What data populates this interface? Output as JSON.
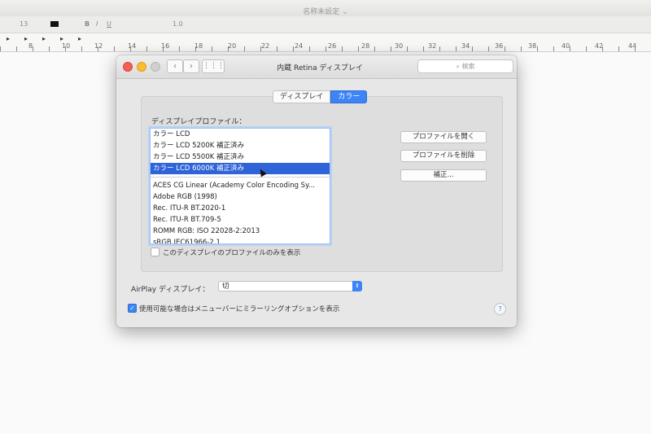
{
  "bg_app": {
    "doc_title": "名称未設定 ⌄",
    "toolbar": {
      "size": "13",
      "bold": "B",
      "italic": "I",
      "underline": "U",
      "spacing": "1.0"
    },
    "ruler_numbers": [
      "8",
      "10",
      "12",
      "14",
      "16",
      "18",
      "20",
      "22",
      "24",
      "26",
      "28",
      "30",
      "32",
      "34",
      "36",
      "38",
      "40",
      "42",
      "44"
    ]
  },
  "window": {
    "title": "内蔵 Retina ディスプレイ",
    "search_placeholder": "検索",
    "tabs": [
      {
        "label": "ディスプレイ"
      },
      {
        "label": "カラー"
      }
    ],
    "profile_label": "ディスプレイプロファイル：",
    "profiles_group1": [
      "カラー LCD",
      "カラー LCD 5200K 補正済み",
      "カラー LCD 5500K 補正済み",
      "カラー LCD 6000K 補正済み"
    ],
    "profiles_group2": [
      "ACES CG Linear (Academy Color Encoding Sy...",
      "Adobe RGB (1998)",
      "Rec. ITU-R BT.2020-1",
      "Rec. ITU-R BT.709-5",
      "ROMM RGB: ISO 22028-2:2013",
      "sRGB IEC61966-2.1"
    ],
    "selected_profile": "カラー LCD 6000K 補正済み",
    "buttons": {
      "open": "プロファイルを開く",
      "delete": "プロファイルを削除",
      "calibrate": "補正..."
    },
    "only_this_display": "このディスプレイのプロファイルのみを表示",
    "airplay_label": "AirPlay ディスプレイ：",
    "airplay_value": "切",
    "mirroring_option": "使用可能な場合はメニューバーにミラーリングオプションを表示",
    "help": "?"
  },
  "colors": {
    "accent": "#3d84f6",
    "selection": "#2f63d8"
  }
}
